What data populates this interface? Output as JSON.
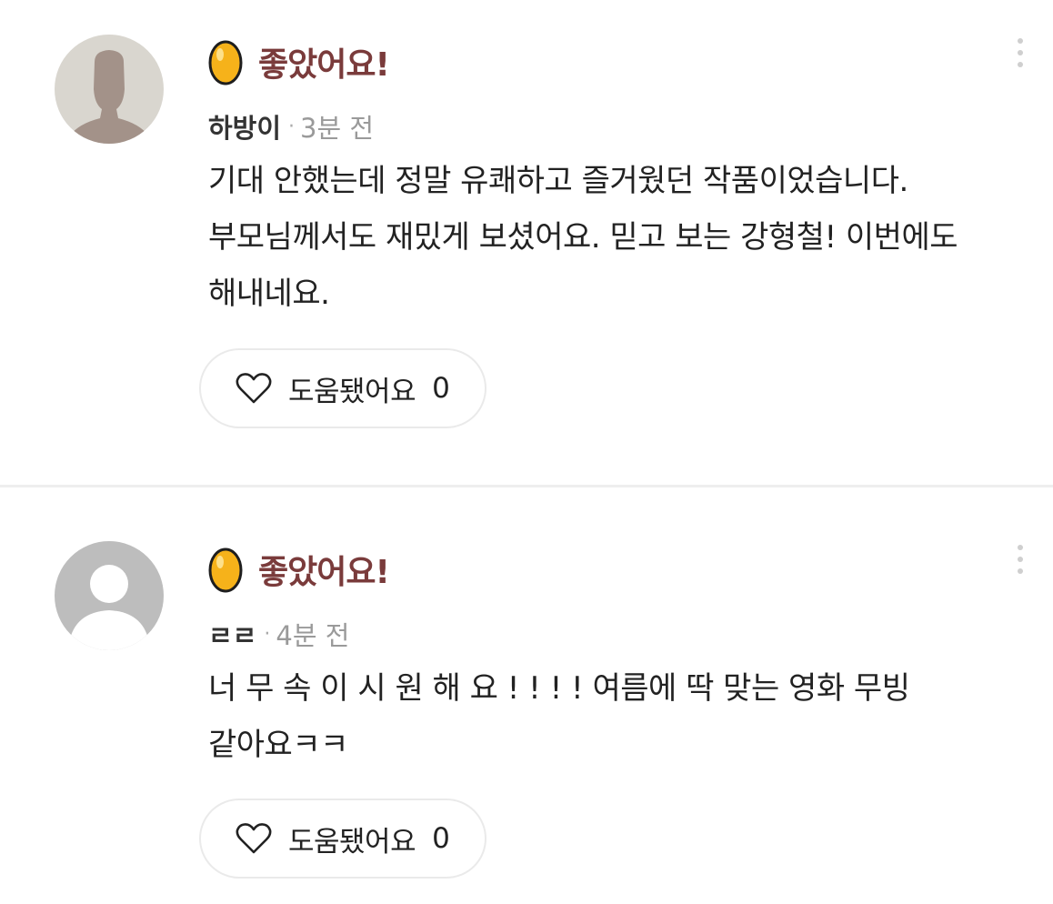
{
  "colors": {
    "rating_label": "#7a3b3b",
    "egg_fill": "#f6b21a",
    "egg_outline": "#1e1e1e",
    "divider": "#eeeeee",
    "helpful_border": "#eaeaea"
  },
  "reviews": [
    {
      "rating_icon": "golden-egg-icon",
      "rating_label": "좋았어요!",
      "author": "하방이",
      "separator": "·",
      "time_ago": "3분 전",
      "body": "기대 안했는데 정말 유쾌하고 즐거웠던 작품이었습니다. 부모님께서도 재밌게 보셨어요. 믿고 보는 강형철! 이번에도 해내네요.",
      "helpful_label": "도움됐어요",
      "helpful_count": "0"
    },
    {
      "rating_icon": "golden-egg-icon",
      "rating_label": "좋았어요!",
      "author": "ㄹㄹ",
      "separator": "·",
      "time_ago": "4분 전",
      "body": "너 무 속 이 시 원 해 요 ! ! ! ! 여름에 딱 맞는 영화 무빙 같아요ㅋㅋ",
      "helpful_label": "도움됐어요",
      "helpful_count": "0"
    }
  ]
}
